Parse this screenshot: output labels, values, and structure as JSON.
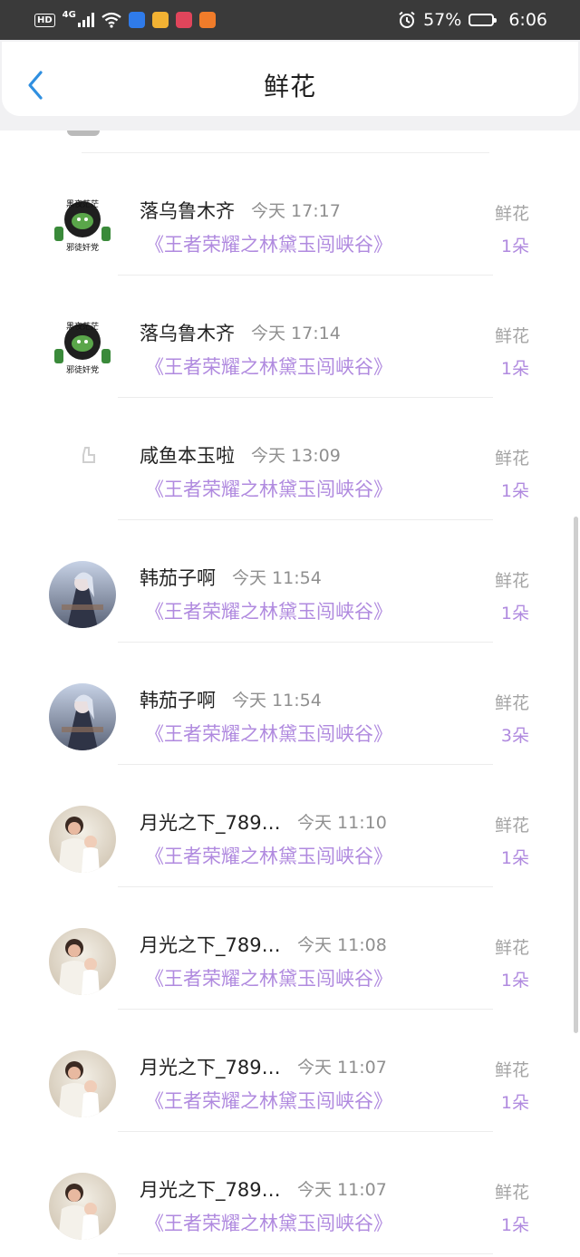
{
  "status_bar": {
    "hd_badge": "HD",
    "network": "4G",
    "battery_percent": "57%",
    "battery_level": 0.57,
    "time": "6:06",
    "icons": [
      "hd-icon",
      "signal-icon",
      "wifi-icon",
      "shield-app-icon",
      "notes-app-icon",
      "book-app-icon",
      "video-app-icon",
      "alarm-icon",
      "battery-icon"
    ]
  },
  "header": {
    "title": "鲜花",
    "back_icon": "chevron-left-icon"
  },
  "colors": {
    "accent": "#b08adf",
    "back": "#2f8fe0"
  },
  "records": [
    {
      "name": "落乌鲁木齐",
      "time": "今天 17:17",
      "book": "《王者荣耀之林黛玉闯峡谷》",
      "gift": "鲜花",
      "count": "1朵",
      "avatar": "sticker-avatar-a"
    },
    {
      "name": "落乌鲁木齐",
      "time": "今天 17:14",
      "book": "《王者荣耀之林黛玉闯峡谷》",
      "gift": "鲜花",
      "count": "1朵",
      "avatar": "sticker-avatar-a"
    },
    {
      "name": "咸鱼本玉啦",
      "time": "今天 13:09",
      "book": "《王者荣耀之林黛玉闯峡谷》",
      "gift": "鲜花",
      "count": "1朵",
      "avatar": "thumb-avatar"
    },
    {
      "name": "韩茄子啊",
      "time": "今天 11:54",
      "book": "《王者荣耀之林黛玉闯峡谷》",
      "gift": "鲜花",
      "count": "1朵",
      "avatar": "anime-avatar"
    },
    {
      "name": "韩茄子啊",
      "time": "今天 11:54",
      "book": "《王者荣耀之林黛玉闯峡谷》",
      "gift": "鲜花",
      "count": "3朵",
      "avatar": "anime-avatar"
    },
    {
      "name": "月光之下_789…",
      "time": "今天 11:10",
      "book": "《王者荣耀之林黛玉闯峡谷》",
      "gift": "鲜花",
      "count": "1朵",
      "avatar": "photo-avatar"
    },
    {
      "name": "月光之下_789…",
      "time": "今天 11:08",
      "book": "《王者荣耀之林黛玉闯峡谷》",
      "gift": "鲜花",
      "count": "1朵",
      "avatar": "photo-avatar"
    },
    {
      "name": "月光之下_789…",
      "time": "今天 11:07",
      "book": "《王者荣耀之林黛玉闯峡谷》",
      "gift": "鲜花",
      "count": "1朵",
      "avatar": "photo-avatar"
    },
    {
      "name": "月光之下_789…",
      "time": "今天 11:07",
      "book": "《王者荣耀之林黛玉闯峡谷》",
      "gift": "鲜花",
      "count": "1朵",
      "avatar": "photo-avatar"
    }
  ]
}
